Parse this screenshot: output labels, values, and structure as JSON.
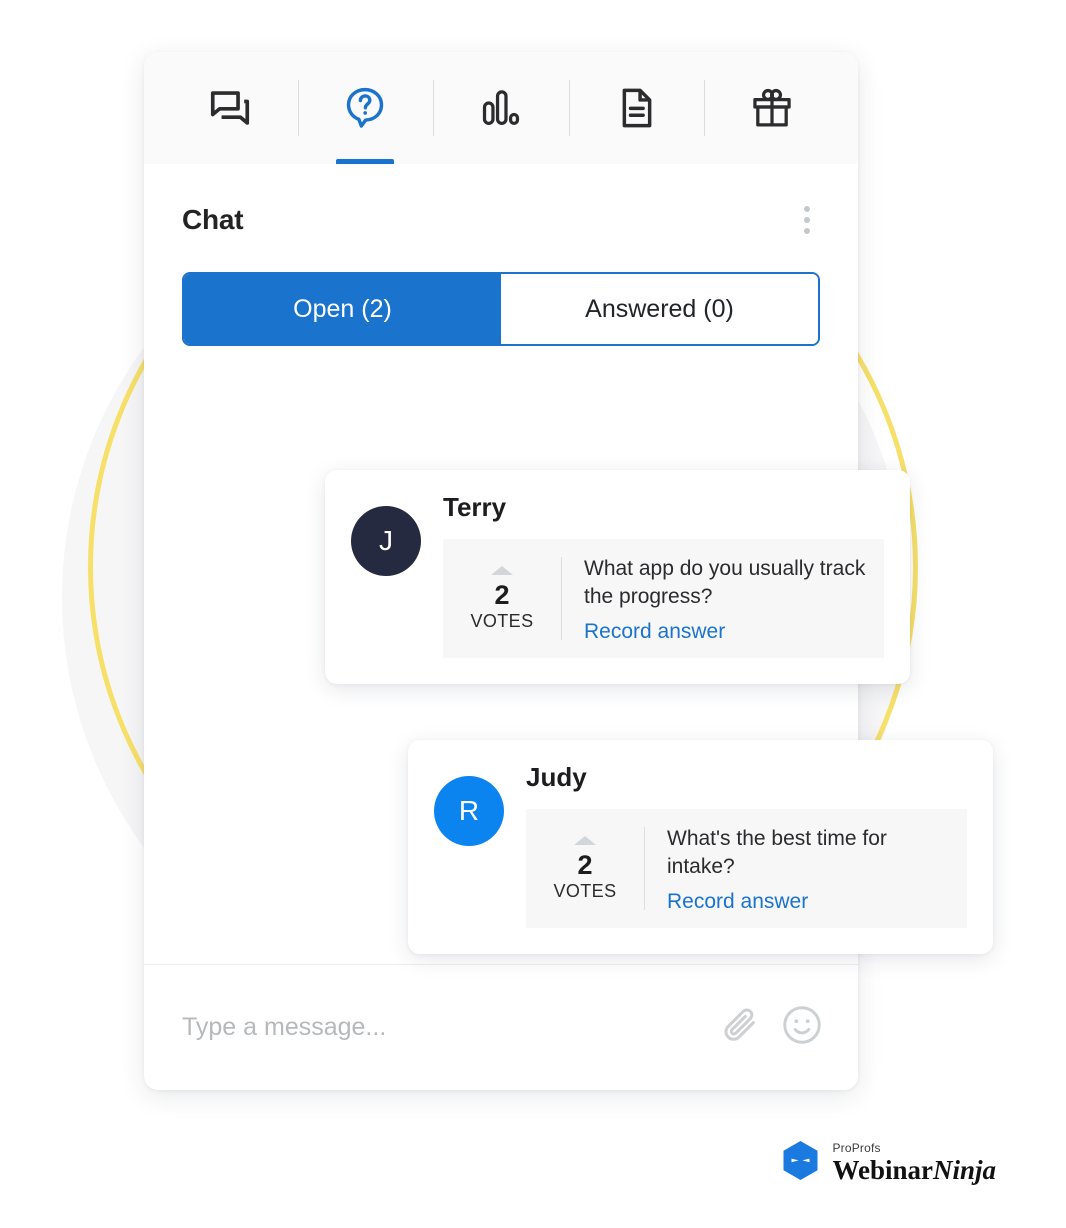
{
  "theme": {
    "accent_blue": "#1a73cc",
    "avatar_navy": "#252a40",
    "avatar_blue": "#0b84ef",
    "decor_yellow": "#f7e06a",
    "decor_gray": "#f6f6f7"
  },
  "toolbar": {
    "tabs": [
      {
        "id": "chat",
        "icon": "forum-icon",
        "label": "Chat",
        "active": false
      },
      {
        "id": "questions",
        "icon": "question-bubble-icon",
        "label": "Questions",
        "active": true
      },
      {
        "id": "polls",
        "icon": "poll-bars-icon",
        "label": "Polls",
        "active": false
      },
      {
        "id": "handouts",
        "icon": "document-icon",
        "label": "Handouts",
        "active": false
      },
      {
        "id": "offers",
        "icon": "gift-icon",
        "label": "Offers",
        "active": false
      }
    ]
  },
  "header": {
    "title": "Chat",
    "menu_icon": "kebab-menu-icon"
  },
  "segmented": {
    "options": [
      {
        "label": "Open (2)",
        "active": true
      },
      {
        "label": "Answered (0)",
        "active": false
      }
    ]
  },
  "questions": [
    {
      "avatar_initial": "J",
      "avatar_color": "navy",
      "name": "Terry",
      "votes": "2",
      "votes_label": "VOTES",
      "text": "What app do you usually track the progress?",
      "action_label": "Record answer"
    },
    {
      "avatar_initial": "R",
      "avatar_color": "blue",
      "name": "Judy",
      "votes": "2",
      "votes_label": "VOTES",
      "text": "What's the best time for intake?",
      "action_label": "Record answer"
    }
  ],
  "composer": {
    "placeholder": "Type a message...",
    "value": "",
    "attach_icon": "paperclip-icon",
    "emoji_icon": "smiley-icon"
  },
  "logo": {
    "mark": "ninja-hexagon-icon",
    "sub": "ProProfs",
    "name_regular": "Webinar",
    "name_italic": "Ninja"
  }
}
